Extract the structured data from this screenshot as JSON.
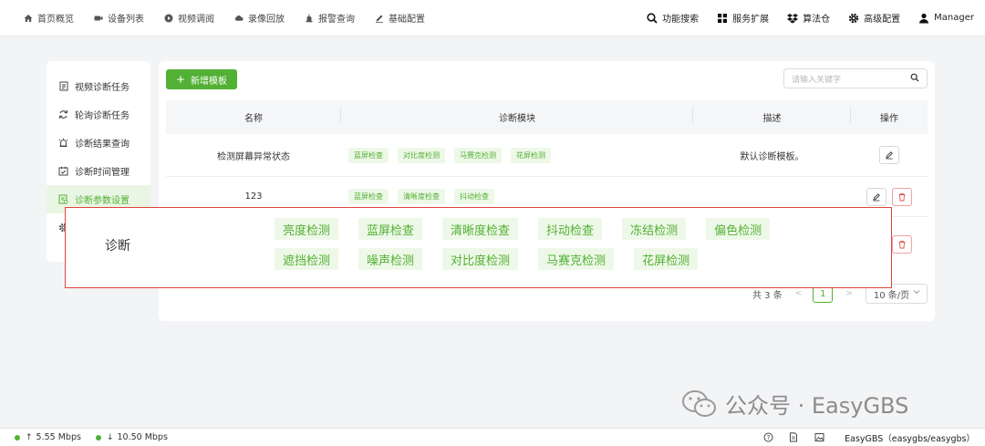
{
  "nav": {
    "left": [
      {
        "icon": "home-icon",
        "label": "首页概览"
      },
      {
        "icon": "camera-icon",
        "label": "设备列表"
      },
      {
        "icon": "play-icon",
        "label": "视频调阅"
      },
      {
        "icon": "cloud-icon",
        "label": "录像回放"
      },
      {
        "icon": "alarm-icon",
        "label": "报警查询"
      },
      {
        "icon": "pen-icon",
        "label": "基础配置"
      }
    ],
    "right": [
      {
        "icon": "search-icon",
        "label": "功能搜索"
      },
      {
        "icon": "grid-icon",
        "label": "服务扩展"
      },
      {
        "icon": "dropbox-icon",
        "label": "算法仓"
      },
      {
        "icon": "gear-icon",
        "label": "高级配置"
      },
      {
        "icon": "user-icon",
        "label": "Manager"
      }
    ]
  },
  "sidebar": {
    "items": [
      {
        "icon": "task-icon",
        "label": "视频诊断任务",
        "active": false
      },
      {
        "icon": "refresh-icon",
        "label": "轮询诊断任务",
        "active": false
      },
      {
        "icon": "result-icon",
        "label": "诊断结果查询",
        "active": false
      },
      {
        "icon": "calendar-icon",
        "label": "诊断时间管理",
        "active": false
      },
      {
        "icon": "settings-doc-icon",
        "label": "诊断参数设置",
        "active": true
      },
      {
        "icon": "gear-icon",
        "label": "",
        "active": false
      }
    ]
  },
  "toolbar": {
    "add_label": "新增模板",
    "search_placeholder": "请输入关键字"
  },
  "table": {
    "headers": [
      "名称",
      "诊断模块",
      "描述",
      "操作"
    ],
    "rows": [
      {
        "name": "检测屏幕异常状态",
        "modules": [
          "蓝屏检查",
          "对比度检测",
          "马赛克检测",
          "花屏检测"
        ],
        "desc": "默认诊断模板。"
      },
      {
        "name": "123",
        "modules": [
          "蓝屏检查",
          "清晰度检查",
          "抖动检查"
        ],
        "desc": ""
      }
    ]
  },
  "pager": {
    "total": "共 3 条",
    "prev": "<",
    "page": "1",
    "next": ">",
    "size": "10 条/页"
  },
  "popover": {
    "label": "诊断",
    "tags_line1": [
      "亮度检测",
      "蓝屏检查",
      "清晰度检查",
      "抖动检查",
      "冻结检测",
      "偏色检测"
    ],
    "tags_line2": [
      "遮挡检测",
      "噪声检测",
      "对比度检测",
      "马赛克检测",
      "花屏检测"
    ]
  },
  "watermark": {
    "text": "公众号 · EasyGBS"
  },
  "status": {
    "upload": "5.55 Mbps",
    "download": "10.50 Mbps",
    "version": "EasyGBS（easygbs/easygbs）",
    "accent": "#52b034"
  }
}
